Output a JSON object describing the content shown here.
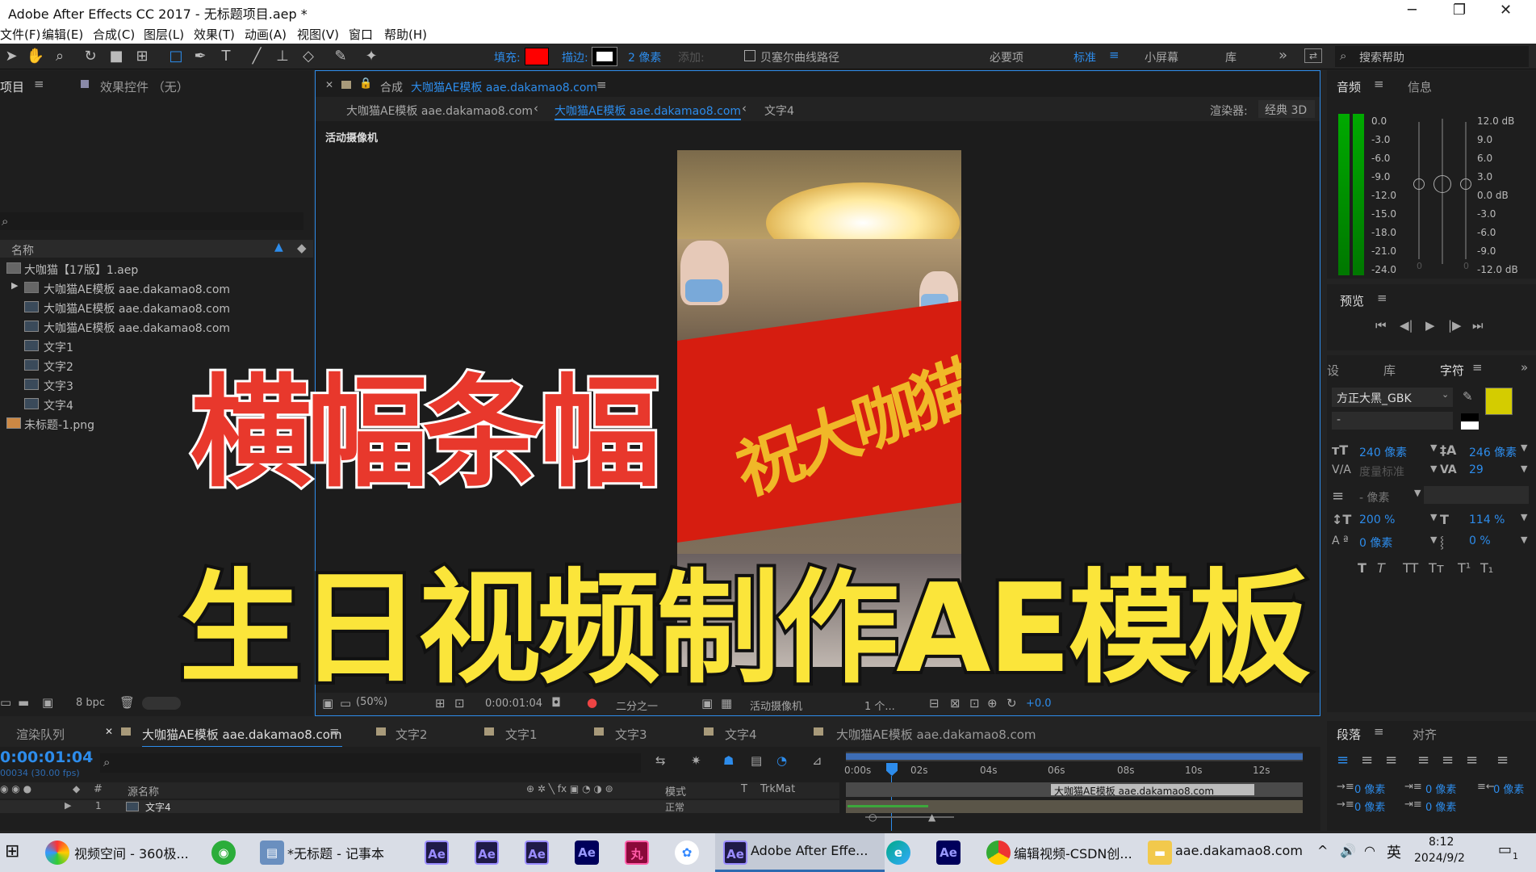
{
  "window": {
    "title": "Adobe After Effects CC 2017 - 无标题项目.aep *",
    "minimize": "─",
    "maximize": "❐",
    "close": "✕"
  },
  "menu": [
    "文件(F)",
    "编辑(E)",
    "合成(C)",
    "图层(L)",
    "效果(T)",
    "动画(A)",
    "视图(V)",
    "窗口",
    "帮助(H)"
  ],
  "toolbar": {
    "fill_label": "填充:",
    "stroke_label": "描边:",
    "stroke_px": "2 像素",
    "add_label": "添加:",
    "bezier_label": "贝塞尔曲线路径",
    "workspaces": [
      "必要项",
      "标准",
      "小屏幕",
      "库"
    ],
    "more": "»",
    "search_placeholder": "搜索帮助",
    "colors": {
      "fill": "#ff0000",
      "accent": "#2d8ceb"
    }
  },
  "project": {
    "tab_project": "项目",
    "tab_effects": "效果控件 （无）",
    "column_name": "名称",
    "items": [
      {
        "name": "大咖猫【17版】1.aep",
        "kind": "folder"
      },
      {
        "name": "大咖猫AE模板 aae.dakamao8.com",
        "kind": "folder"
      },
      {
        "name": "大咖猫AE模板 aae.dakamao8.com",
        "kind": "comp"
      },
      {
        "name": "大咖猫AE模板 aae.dakamao8.com",
        "kind": "comp"
      },
      {
        "name": "文字1",
        "kind": "comp"
      },
      {
        "name": "文字2",
        "kind": "comp"
      },
      {
        "name": "文字3",
        "kind": "comp"
      },
      {
        "name": "文字4",
        "kind": "comp"
      },
      {
        "name": "未标题-1.png",
        "kind": "image"
      }
    ],
    "bpc": "8 bpc"
  },
  "composition": {
    "header_prefix": "合成",
    "header_name": "大咖猫AE模板 aae.dakamao8.com",
    "crumbs": [
      "大咖猫AE模板 aae.dakamao8.com",
      "大咖猫AE模板 aae.dakamao8.com",
      "文字4"
    ],
    "renderer_label": "渲染器:",
    "renderer_value": "经典 3D",
    "camera_label": "活动摄像机",
    "footer": {
      "zoom": "(50%)",
      "timecode": "0:00:01:04",
      "resolution": "二分之一",
      "camera": "活动摄像机",
      "views": "1 个...",
      "exposure": "+0.0"
    }
  },
  "overlay": {
    "line1": "横幅条幅",
    "line2": "生日视频制作AE模板",
    "banner_text": "祝大咖猫"
  },
  "audio": {
    "tab_audio": "音频",
    "tab_info": "信息",
    "left_scale": [
      "0.0",
      "-3.0",
      "-6.0",
      "-9.0",
      "-12.0",
      "-15.0",
      "-18.0",
      "-21.0",
      "-24.0"
    ],
    "right_scale": [
      "12.0 dB",
      "9.0",
      "6.0",
      "3.0",
      "0.0 dB",
      "-3.0",
      "-6.0",
      "-9.0",
      "-12.0 dB"
    ],
    "zero_a": "0",
    "zero_b": "0"
  },
  "preview": {
    "label": "预览"
  },
  "character": {
    "tabs": [
      "设",
      "库",
      "字符"
    ],
    "font": "方正大黑_GBK",
    "style": "-",
    "size": "240 像素",
    "leading": "246 像素",
    "kerning": "度量标准",
    "tracking": "29",
    "stroke_width": "- 像素",
    "vscale": "200 %",
    "hscale": "114 %",
    "baseline": "0 像素",
    "tsume": "0 %",
    "styles": [
      "T",
      "T",
      "TT",
      "Tт",
      "T¹",
      "T₁"
    ],
    "colors": {
      "fill": "#d4cc00"
    }
  },
  "timeline": {
    "tab_render": "渲染队列",
    "tabs": [
      "大咖猫AE模板 aae.dakamao8.com",
      "文字2",
      "文字1",
      "文字3",
      "文字4",
      "大咖猫AE模板 aae.dakamao8.com"
    ],
    "timecode": "0:00:01:04",
    "frames": "00034 (30.00 fps)",
    "col_source": "源名称",
    "col_mode": "模式",
    "col_t": "T",
    "col_trkmat": "TrkMat",
    "layer_num": "1",
    "layer_name": "文字4",
    "layer_mode": "正常",
    "ruler": [
      "0:00s",
      "02s",
      "04s",
      "06s",
      "08s",
      "10s",
      "12s"
    ],
    "bar_label": "大咖猫AE模板 aae.dakamao8.com"
  },
  "paragraph": {
    "tab": "段落",
    "tab2": "对齐",
    "indent": [
      "0 像素",
      "0 像素",
      "0 像素",
      "0 像素",
      "0 像素"
    ]
  },
  "taskbar": {
    "items": [
      "视频空间 - 360极...",
      "*无标题 - 记事本",
      "Adobe After Effe...",
      "编辑视频-CSDN创...",
      "aae.dakamao8.com"
    ],
    "ime": "英",
    "time": "8:12",
    "date": "2024/9/2",
    "notif": "1"
  }
}
